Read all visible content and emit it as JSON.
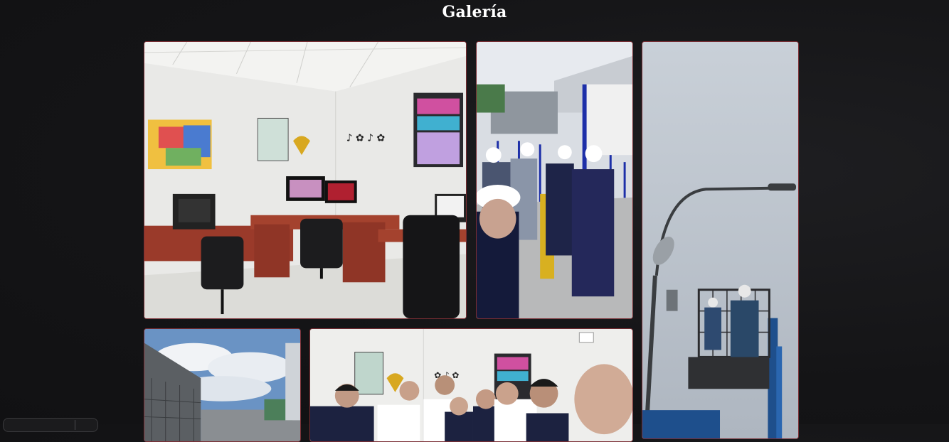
{
  "gallery": {
    "title": "Galería",
    "photos": [
      {
        "alt": "Oficina con escritorios y computadoras"
      },
      {
        "alt": "Grupo de trabajadores con cascos"
      },
      {
        "alt": "Técnicos en canasta elevadora junto a poste"
      },
      {
        "alt": "Instalaciones exteriores"
      },
      {
        "alt": "Grupo de personas en oficina"
      }
    ]
  }
}
